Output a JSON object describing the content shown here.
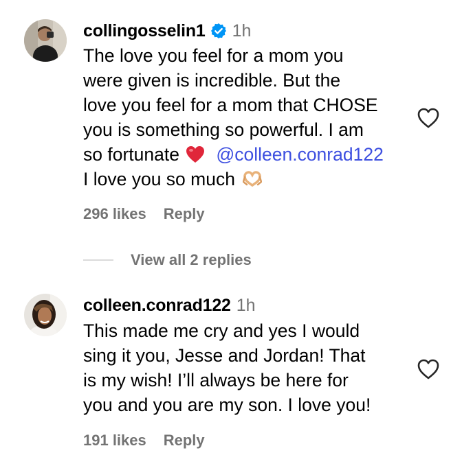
{
  "comments": [
    {
      "username": "collingosselin1",
      "verified": true,
      "time": "1h",
      "lines": [
        "The love you feel for a mom you",
        "were given is incredible. But the",
        "love you feel for a mom that CHOSE",
        "you is something so powerful. I am"
      ],
      "line5_before": "so fortunate ",
      "line5_emoji": "red-heart-emoji",
      "line5_mention": "@colleen.conrad122",
      "line6_text": "I love you so much ",
      "line6_emoji": "heart-hands-emoji",
      "likes": "296 likes",
      "reply_label": "Reply"
    },
    {
      "username": "colleen.conrad122",
      "verified": false,
      "time": "1h",
      "lines": [
        "This made me cry and yes I would",
        "sing it you, Jesse and Jordan! That",
        "is my wish! I’ll always be here for",
        "you and you are my son. I love you!"
      ],
      "likes": "191 likes",
      "reply_label": "Reply"
    }
  ],
  "view_replies": "View all 2 replies",
  "colors": {
    "text": "#000000",
    "secondary": "#737373",
    "mention": "#3d4fe0",
    "verified": "#0095f6",
    "divider": "#dbdbdb"
  },
  "icons": {
    "verified": "verified-badge-icon",
    "like": "heart-outline-icon"
  }
}
